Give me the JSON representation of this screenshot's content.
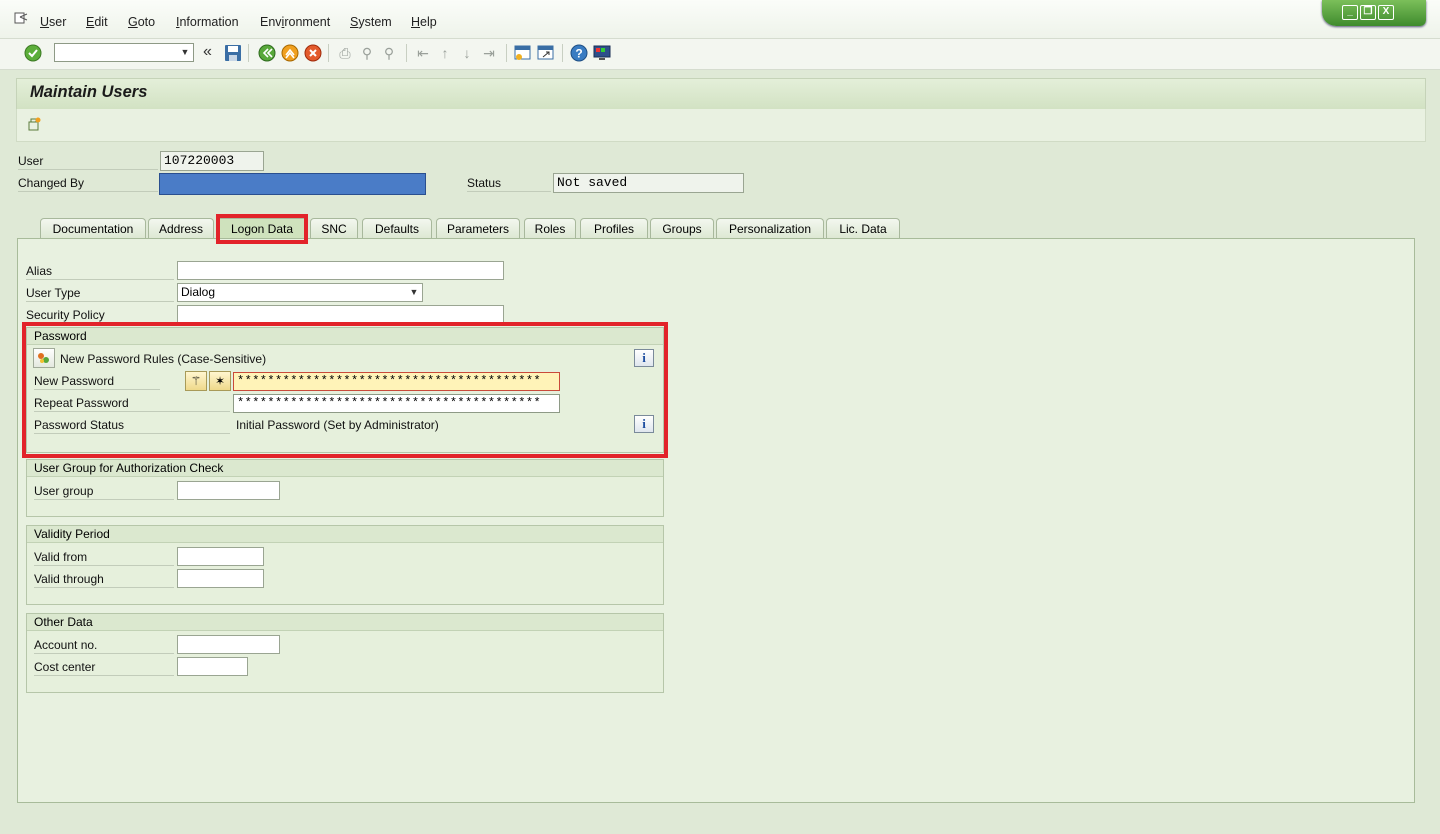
{
  "menu": {
    "items": [
      {
        "label": "User",
        "u": "U",
        "rest": "ser"
      },
      {
        "label": "Edit",
        "u": "E",
        "rest": "dit"
      },
      {
        "label": "Goto",
        "u": "G",
        "rest": "oto"
      },
      {
        "label": "Information",
        "u": "I",
        "rest": "nformation"
      },
      {
        "label": "Environment",
        "pre": "Env",
        "u": "i",
        "rest": "ronment"
      },
      {
        "label": "System",
        "u": "S",
        "rest": "ystem"
      },
      {
        "label": "Help",
        "u": "H",
        "rest": "elp"
      }
    ]
  },
  "window_controls": {
    "minimize": "_",
    "restore": "❐",
    "close": "X"
  },
  "toolbar": {
    "command_field_value": "",
    "icons": [
      "enter-icon",
      "back-nav-icon",
      "save-icon",
      "back-icon",
      "exit-icon",
      "cancel-icon",
      "print-icon",
      "find-icon",
      "find-next-icon",
      "first-page-icon",
      "prev-page-icon",
      "next-page-icon",
      "last-page-icon",
      "create-session-icon",
      "shortcut-icon",
      "help-icon",
      "customize-layout-icon"
    ]
  },
  "page": {
    "title": "Maintain Users"
  },
  "header": {
    "user_label": "User",
    "user_value": "107220003",
    "changed_by_label": "Changed By",
    "changed_by_value": "",
    "status_label": "Status",
    "status_value": "Not saved"
  },
  "tabs": [
    {
      "label": "Documentation"
    },
    {
      "label": "Address"
    },
    {
      "label": "Logon Data",
      "active": true
    },
    {
      "label": "SNC"
    },
    {
      "label": "Defaults"
    },
    {
      "label": "Parameters"
    },
    {
      "label": "Roles"
    },
    {
      "label": "Profiles"
    },
    {
      "label": "Groups"
    },
    {
      "label": "Personalization"
    },
    {
      "label": "Lic. Data"
    }
  ],
  "logon": {
    "alias_label": "Alias",
    "alias_value": "",
    "user_type_label": "User Type",
    "user_type_value": "Dialog",
    "security_policy_label": "Security Policy",
    "security_policy_value": "",
    "password": {
      "heading": "Password",
      "rules_text": "New Password Rules (Case-Sensitive)",
      "new_label": "New Password",
      "new_value": "****************************************",
      "repeat_label": "Repeat Password",
      "repeat_value": "****************************************",
      "status_label": "Password Status",
      "status_value": "Initial Password (Set by Administrator)",
      "info_glyph": "i"
    },
    "user_group": {
      "heading": "User Group for Authorization Check",
      "label": "User group",
      "value": ""
    },
    "validity": {
      "heading": "Validity Period",
      "from_label": "Valid from",
      "from_value": "",
      "through_label": "Valid through",
      "through_value": ""
    },
    "other": {
      "heading": "Other Data",
      "account_label": "Account no.",
      "account_value": "",
      "cost_label": "Cost center",
      "cost_value": ""
    }
  },
  "colors": {
    "highlight_red": "#e2232a",
    "redacted_blue": "#4a7cc7",
    "password_field_yellow": "#fff3b8",
    "sap_green": "#e8f1e0"
  }
}
